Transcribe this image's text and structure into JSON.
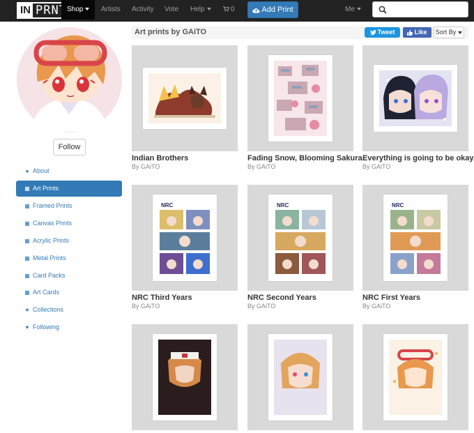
{
  "header": {
    "logo_in": "IN",
    "logo_prnt": "PRNT",
    "nav": [
      {
        "label": "Shop",
        "has_caret": true
      },
      {
        "label": "Artists"
      },
      {
        "label": "Activity"
      },
      {
        "label": "Vote"
      },
      {
        "label": "Help",
        "has_caret": true
      },
      {
        "label": "0"
      }
    ],
    "add_print_label": "Add Print",
    "me_label": "Me",
    "search_placeholder": ""
  },
  "profile": {
    "follow_label": "Follow"
  },
  "sidebar": {
    "items": [
      {
        "label": "About",
        "icon": "user-icon"
      },
      {
        "label": "Art Prints",
        "icon": "grid-icon",
        "active": true
      },
      {
        "label": "Framed Prints",
        "icon": "grid-icon"
      },
      {
        "label": "Canvas Prints",
        "icon": "grid-icon"
      },
      {
        "label": "Acrylic Prints",
        "icon": "grid-icon"
      },
      {
        "label": "Metal Prints",
        "icon": "grid-icon"
      },
      {
        "label": "Card Packs",
        "icon": "grid-icon"
      },
      {
        "label": "Art Cards",
        "icon": "grid-icon"
      },
      {
        "label": "Collections",
        "icon": "star-icon"
      },
      {
        "label": "Following",
        "icon": "heart-icon"
      }
    ]
  },
  "main": {
    "title": "Art prints by GAiTO",
    "tweet_label": "Tweet",
    "like_label": "Like",
    "sort_label": "Sort By",
    "prints": [
      {
        "title": "Indian Brothers",
        "by": "By GAiTO"
      },
      {
        "title": "Fading Snow, Blooming Sakura.",
        "by": "By GAiTO"
      },
      {
        "title": "Everything is going to be okay.",
        "by": "By GAiTO"
      },
      {
        "title": "NRC Third Years",
        "by": "By GAiTO"
      },
      {
        "title": "NRC Second Years",
        "by": "By GAiTO"
      },
      {
        "title": "NRC First Years",
        "by": "By GAiTO"
      },
      {
        "title": "",
        "by": ""
      },
      {
        "title": "",
        "by": ""
      },
      {
        "title": "",
        "by": ""
      }
    ]
  },
  "colors": {
    "topbar": "#222222",
    "accent": "#337ab7",
    "tweet": "#1b95e0",
    "facebook": "#4267b2"
  }
}
